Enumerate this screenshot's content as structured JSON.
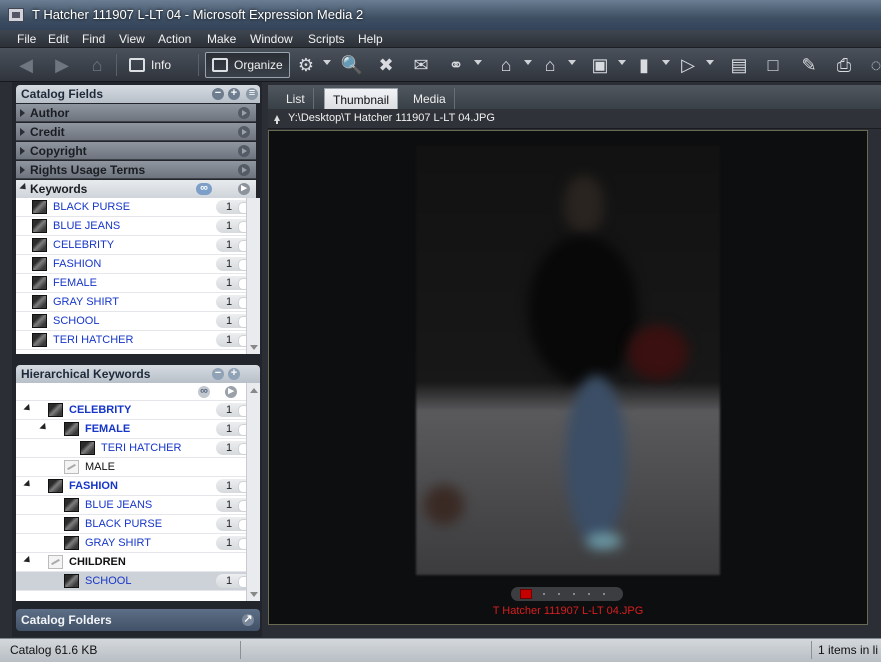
{
  "window": {
    "title": "T Hatcher 111907 L-LT 04 - Microsoft Expression Media 2"
  },
  "menu": [
    "File",
    "Edit",
    "Find",
    "View",
    "Action",
    "Make",
    "Window",
    "Scripts",
    "Help"
  ],
  "toolbar": {
    "info_label": "Info",
    "organize_label": "Organize"
  },
  "catalog_fields": {
    "title": "Catalog Fields",
    "fields": [
      "Author",
      "Credit",
      "Copyright",
      "Rights Usage Terms"
    ],
    "keywords_label": "Keywords",
    "keywords": [
      {
        "label": "BLACK PURSE",
        "count": "1"
      },
      {
        "label": "BLUE JEANS",
        "count": "1"
      },
      {
        "label": "CELEBRITY",
        "count": "1"
      },
      {
        "label": "FASHION",
        "count": "1"
      },
      {
        "label": "FEMALE",
        "count": "1"
      },
      {
        "label": "GRAY SHIRT",
        "count": "1"
      },
      {
        "label": "SCHOOL",
        "count": "1"
      },
      {
        "label": "TERI HATCHER",
        "count": "1"
      }
    ]
  },
  "hierarchical": {
    "title": "Hierarchical Keywords",
    "items": [
      {
        "label": "CELEBRITY",
        "count": "1",
        "level": 0,
        "expanded": true,
        "bold": true
      },
      {
        "label": "FEMALE",
        "count": "1",
        "level": 1,
        "expanded": true,
        "bold": true
      },
      {
        "label": "TERI HATCHER",
        "count": "1",
        "level": 2,
        "expanded": false,
        "bold": false
      },
      {
        "label": "MALE",
        "count": "",
        "level": 1,
        "expanded": false,
        "bold": false,
        "empty": true
      },
      {
        "label": "FASHION",
        "count": "1",
        "level": 0,
        "expanded": true,
        "bold": true
      },
      {
        "label": "BLUE JEANS",
        "count": "1",
        "level": 1,
        "expanded": false,
        "bold": false
      },
      {
        "label": "BLACK PURSE",
        "count": "1",
        "level": 1,
        "expanded": false,
        "bold": false
      },
      {
        "label": "GRAY SHIRT",
        "count": "1",
        "level": 1,
        "expanded": false,
        "bold": false
      },
      {
        "label": "CHILDREN",
        "count": "",
        "level": 0,
        "expanded": true,
        "bold": true,
        "empty": true
      },
      {
        "label": "SCHOOL",
        "count": "1",
        "level": 1,
        "expanded": false,
        "bold": false,
        "selected": true
      }
    ]
  },
  "catalog_folders": {
    "title": "Catalog Folders"
  },
  "tabs": [
    {
      "label": "List",
      "active": false
    },
    {
      "label": "Thumbnail",
      "active": true
    },
    {
      "label": "Media",
      "active": false
    }
  ],
  "path": "Y:\\Desktop\\T Hatcher 111907 L-LT 04.JPG",
  "caption": "T Hatcher 111907 L-LT 04.JPG",
  "status": {
    "left": "Catalog  61.6 KB",
    "right": "1 items in li"
  },
  "colors": {
    "keyword_link": "#1636c8",
    "caption": "#d81e1e",
    "filmstrip_current": "#c40000"
  }
}
